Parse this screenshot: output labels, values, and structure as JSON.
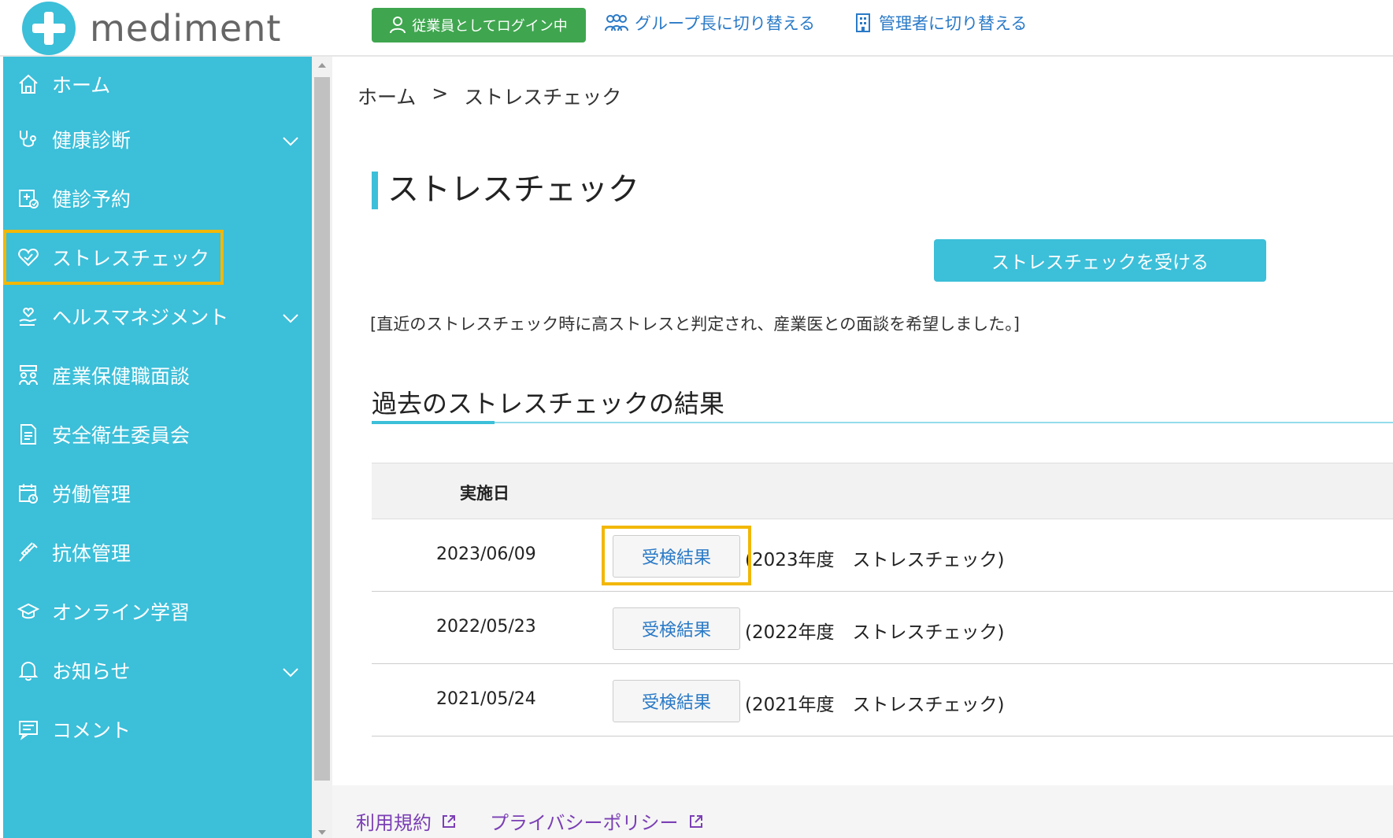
{
  "header": {
    "logo_text": "mediment",
    "login_status": "従業員としてログイン中",
    "switch_group": "グループ長に切り替える",
    "switch_admin": "管理者に切り替える"
  },
  "sidebar": {
    "items": [
      {
        "label": "ホーム",
        "icon": "home-icon",
        "has_chevron": false
      },
      {
        "label": "健康診断",
        "icon": "stethoscope-icon",
        "has_chevron": true
      },
      {
        "label": "健診予約",
        "icon": "reservation-icon",
        "has_chevron": false
      },
      {
        "label": "ストレスチェック",
        "icon": "heart-check-icon",
        "has_chevron": false
      },
      {
        "label": "ヘルスマネジメント",
        "icon": "care-icon",
        "has_chevron": true
      },
      {
        "label": "産業保健職面談",
        "icon": "meeting-icon",
        "has_chevron": false
      },
      {
        "label": "安全衛生委員会",
        "icon": "document-icon",
        "has_chevron": false
      },
      {
        "label": "労働管理",
        "icon": "calendar-clock-icon",
        "has_chevron": false
      },
      {
        "label": "抗体管理",
        "icon": "syringe-icon",
        "has_chevron": false
      },
      {
        "label": "オンライン学習",
        "icon": "graduation-cap-icon",
        "has_chevron": false
      },
      {
        "label": "お知らせ",
        "icon": "bell-icon",
        "has_chevron": true
      },
      {
        "label": "コメント",
        "icon": "comment-icon",
        "has_chevron": false
      }
    ]
  },
  "breadcrumb": {
    "home": "ホーム",
    "separator": ">",
    "current": "ストレスチェック"
  },
  "main": {
    "title": "ストレスチェック",
    "take_button": "ストレスチェックを受ける",
    "notice": "[直近のストレスチェック時に高ストレスと判定され、産業医との面談を希望しました。]",
    "section_title": "過去のストレスチェックの結果",
    "table": {
      "header_date": "実施日",
      "rows": [
        {
          "date": "2023/06/09",
          "button": "受検結果",
          "desc": "(2023年度　ストレスチェック)"
        },
        {
          "date": "2022/05/23",
          "button": "受検結果",
          "desc": "(2022年度　ストレスチェック)"
        },
        {
          "date": "2021/05/24",
          "button": "受検結果",
          "desc": "(2021年度　ストレスチェック)"
        }
      ]
    }
  },
  "footer": {
    "terms": "利用規約",
    "privacy": "プライバシーポリシー"
  },
  "colors": {
    "accent": "#3cbfd9",
    "login_green": "#3fa64f",
    "highlight": "#f2b705",
    "link_blue": "#2a7ac7",
    "footer_link": "#7b3fb5"
  }
}
